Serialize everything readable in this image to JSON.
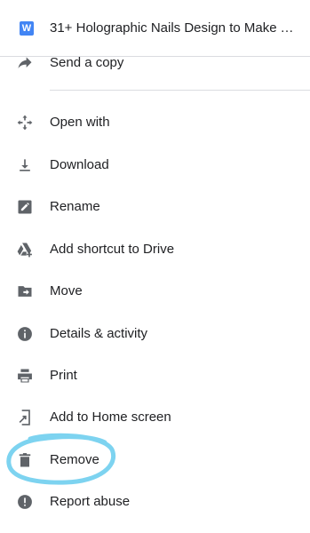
{
  "header": {
    "file_type_letter": "W",
    "file_name": "31+ Holographic Nails Design to Make Yo..."
  },
  "menu": [
    {
      "icon": "share-arrow-icon",
      "label": "Send a copy"
    },
    {
      "icon": "open-with-icon",
      "label": "Open with"
    },
    {
      "icon": "download-icon",
      "label": "Download"
    },
    {
      "icon": "rename-pencil-icon",
      "label": "Rename"
    },
    {
      "icon": "drive-shortcut-icon",
      "label": "Add shortcut to Drive"
    },
    {
      "icon": "move-folder-icon",
      "label": "Move"
    },
    {
      "icon": "info-icon",
      "label": "Details & activity"
    },
    {
      "icon": "printer-icon",
      "label": "Print"
    },
    {
      "icon": "add-to-home-icon",
      "label": "Add to Home screen"
    },
    {
      "icon": "trash-icon",
      "label": "Remove"
    },
    {
      "icon": "report-icon",
      "label": "Report abuse"
    }
  ],
  "colors": {
    "icon": "#5f6368",
    "text": "#202124",
    "doc_icon": "#4285f4",
    "highlight_circle": "#7dd3f0"
  }
}
